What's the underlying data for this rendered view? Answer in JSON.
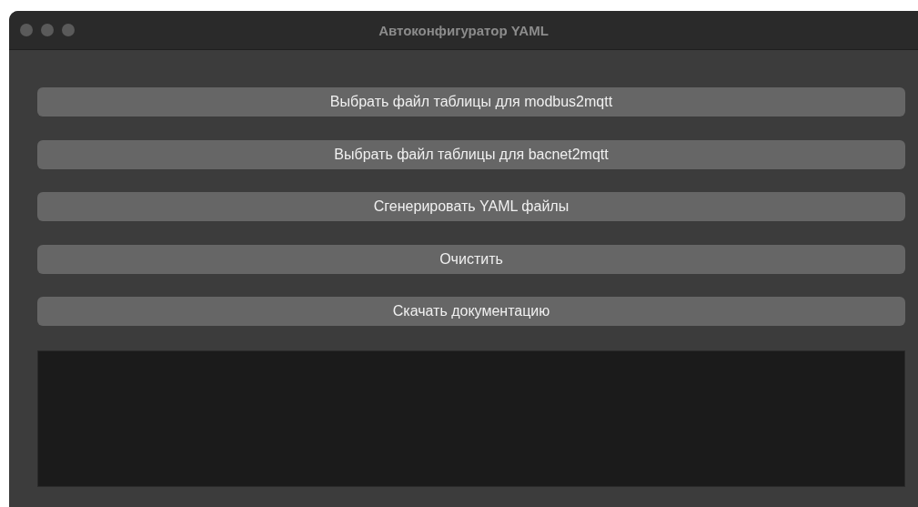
{
  "window": {
    "title": "Автоконфигуратор YAML"
  },
  "buttons": [
    "Выбрать файл таблицы для modbus2mqtt",
    "Выбрать файл таблицы для bacnet2mqtt",
    "Сгенерировать YAML файлы",
    "Очистить",
    "Скачать документацию"
  ]
}
